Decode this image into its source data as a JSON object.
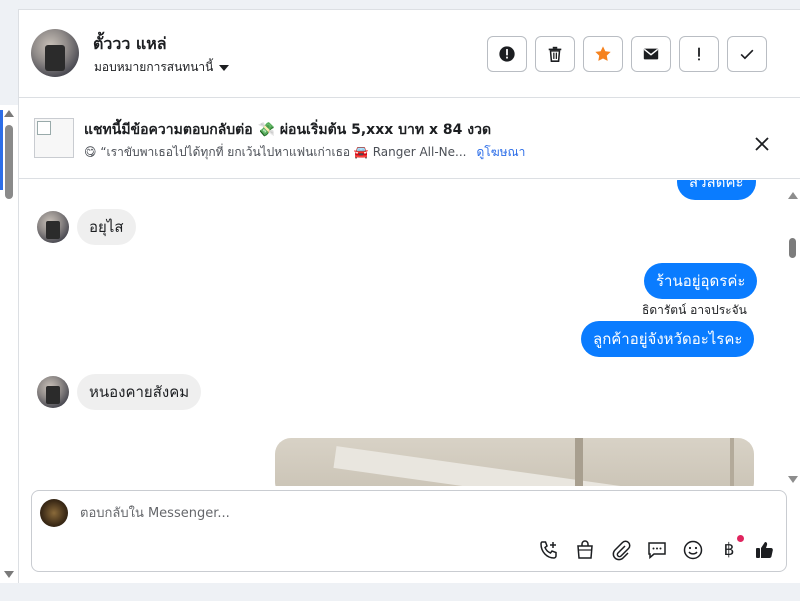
{
  "header": {
    "name": "ตั้ววว แหล่",
    "assign_label": "มอบหมายการสนทนานี้",
    "actions": [
      {
        "id": "spam",
        "icon": "alert-circle-icon"
      },
      {
        "id": "delete",
        "icon": "trash-icon"
      },
      {
        "id": "star",
        "icon": "star-icon",
        "color": "#f5821f"
      },
      {
        "id": "mail",
        "icon": "envelope-icon"
      },
      {
        "id": "important",
        "icon": "exclamation-icon"
      },
      {
        "id": "done",
        "icon": "checkmark-icon"
      }
    ]
  },
  "ad": {
    "title": "แชทนี้มีข้อความตอบกลับต่อ 💸 ผ่อนเริ่มต้น 5,xxx บาท x 84 งวด",
    "subtitle": "😋 “เราขับพาเธอไปได้ทุกที่ ยกเว้นไปหาแฟนเก่าเธอ 🚘 Ranger All-Ne...",
    "link": "ดูโฆษณา"
  },
  "messages": [
    {
      "id": "m0",
      "side": "out",
      "text": "สวัสดีค่ะ"
    },
    {
      "id": "m1",
      "side": "in",
      "text": "อยุไส"
    },
    {
      "id": "m2",
      "side": "out",
      "text": "ร้านอยู่อุดรค่ะ"
    },
    {
      "id": "m3",
      "side": "out",
      "sender": "ธิดารัตน์ อาจประจัน",
      "text": "ลูกค้าอยู่จังหวัดอะไรคะ"
    },
    {
      "id": "m4",
      "side": "in",
      "text": "หนองคายสังคม"
    }
  ],
  "composer": {
    "placeholder": "ตอบกลับใน Messenger...",
    "tools": [
      "phone-plus-icon",
      "shopping-bag-icon",
      "paperclip-icon",
      "chat-bubble-icon",
      "smiley-icon",
      "baht-icon",
      "thumbs-up-icon"
    ],
    "baht_symbol": "฿"
  },
  "colors": {
    "accent": "#0a7cff",
    "star": "#f5821f",
    "notification": "#e0245e"
  }
}
